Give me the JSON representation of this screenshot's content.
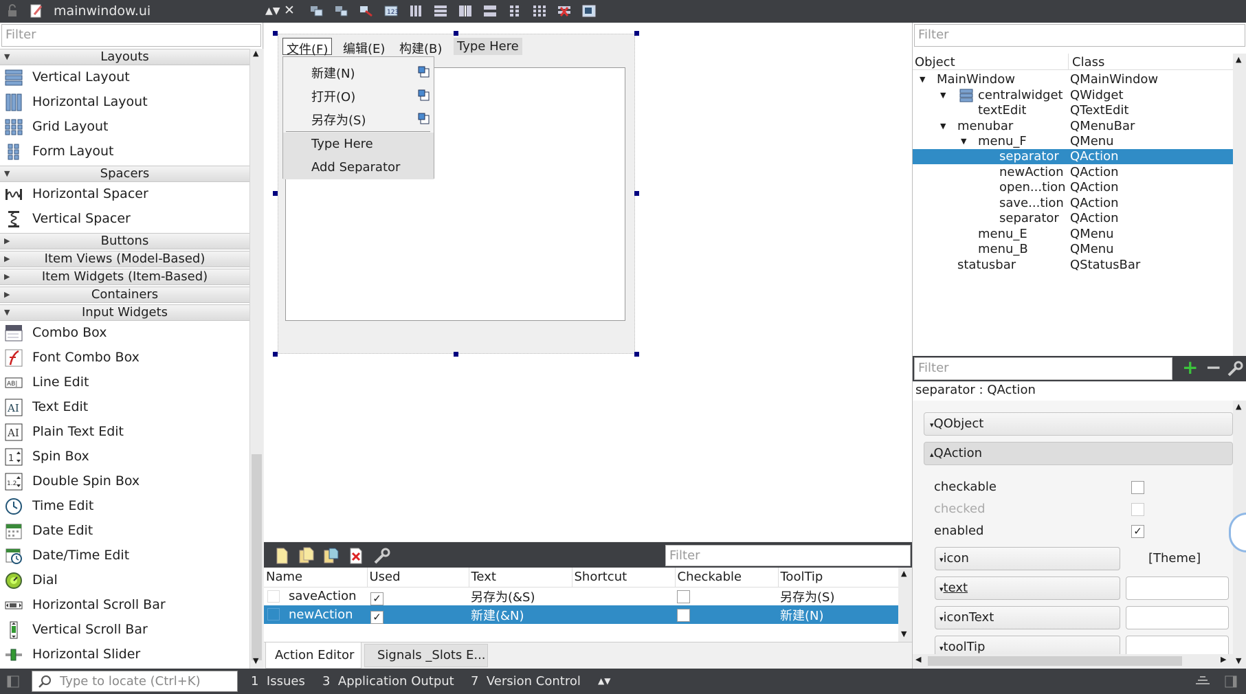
{
  "topbar": {
    "filename": "mainwindow.ui"
  },
  "widget_box": {
    "filter_placeholder": "Filter",
    "categories": {
      "layouts": "Layouts",
      "spacers": "Spacers",
      "buttons": "Buttons",
      "item_views": "Item Views (Model-Based)",
      "item_widgets": "Item Widgets (Item-Based)",
      "containers": "Containers",
      "input_widgets": "Input Widgets"
    },
    "layouts": [
      "Vertical Layout",
      "Horizontal Layout",
      "Grid Layout",
      "Form Layout"
    ],
    "spacers": [
      "Horizontal Spacer",
      "Vertical Spacer"
    ],
    "input_widgets": [
      "Combo Box",
      "Font Combo Box",
      "Line Edit",
      "Text Edit",
      "Plain Text Edit",
      "Spin Box",
      "Double Spin Box",
      "Time Edit",
      "Date Edit",
      "Date/Time Edit",
      "Dial",
      "Horizontal Scroll Bar",
      "Vertical Scroll Bar",
      "Horizontal Slider"
    ]
  },
  "form": {
    "menubar": [
      "文件(F)",
      "编辑(E)",
      "构建(B)",
      "Type Here"
    ],
    "dropdown": [
      "新建(N)",
      "打开(O)",
      "另存为(S)",
      "Type Here",
      "Add Separator"
    ]
  },
  "action_editor": {
    "filter_placeholder": "Filter",
    "columns": [
      "Name",
      "Used",
      "Text",
      "Shortcut",
      "Checkable",
      "ToolTip"
    ],
    "rows": [
      {
        "name": "saveAction",
        "text": "另存为(&S)",
        "tooltip": "另存为(S)"
      },
      {
        "name": "newAction",
        "text": "新建(&N)",
        "tooltip": "新建(N)"
      }
    ],
    "tabs": [
      "Action Editor",
      "Signals _Slots E..."
    ]
  },
  "object_inspector": {
    "filter_placeholder": "Filter",
    "columns": [
      "Object",
      "Class"
    ],
    "rows": [
      {
        "obj": "MainWindow",
        "cls": "QMainWindow"
      },
      {
        "obj": "centralwidget",
        "cls": "QWidget"
      },
      {
        "obj": "textEdit",
        "cls": "QTextEdit"
      },
      {
        "obj": "menubar",
        "cls": "QMenuBar"
      },
      {
        "obj": "menu_F",
        "cls": "QMenu"
      },
      {
        "obj": "separator",
        "cls": "QAction"
      },
      {
        "obj": "newAction",
        "cls": "QAction"
      },
      {
        "obj": "open...tion",
        "cls": "QAction"
      },
      {
        "obj": "save...tion",
        "cls": "QAction"
      },
      {
        "obj": "separator",
        "cls": "QAction"
      },
      {
        "obj": "menu_E",
        "cls": "QMenu"
      },
      {
        "obj": "menu_B",
        "cls": "QMenu"
      },
      {
        "obj": "statusbar",
        "cls": "QStatusBar"
      }
    ]
  },
  "property_editor": {
    "filter_placeholder": "Filter",
    "object_label": "separator : QAction",
    "groups": [
      "QObject",
      "QAction"
    ],
    "props": {
      "checkable": "checkable",
      "checked": "checked",
      "enabled": "enabled",
      "icon": "icon",
      "icon_value": "[Theme]",
      "text": "text",
      "iconText": "iconText",
      "toolTip": "toolTip"
    }
  },
  "bottombar": {
    "locate_placeholder": "Type to locate (Ctrl+K)",
    "issues": "1  Issues",
    "app_output": "3  Application Output",
    "version_control": "7  Version Control"
  }
}
